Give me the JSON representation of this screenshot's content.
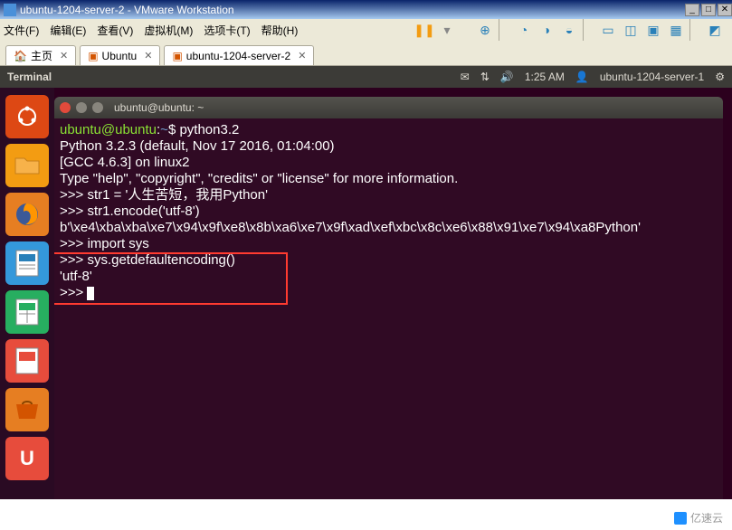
{
  "window": {
    "title": "ubuntu-1204-server-2 - VMware Workstation",
    "btn_min": "_",
    "btn_max": "□",
    "btn_close": "✕"
  },
  "menu": {
    "file": "文件(F)",
    "edit": "编辑(E)",
    "view": "查看(V)",
    "vm": "虚拟机(M)",
    "tabs": "选项卡(T)",
    "help": "帮助(H)"
  },
  "tabs": {
    "home": "主页",
    "t1": "Ubuntu",
    "t2": "ubuntu-1204-server-2"
  },
  "ubuntu_top": {
    "app": "Terminal",
    "time": "1:25 AM",
    "user": "ubuntu-1204-server-1"
  },
  "launcher": {
    "usc": "U"
  },
  "terminal": {
    "title": "ubuntu@ubuntu: ~",
    "prompt_user": "ubuntu@ubuntu",
    "prompt_path": "~",
    "cmd1": "python3.2",
    "out1": "Python 3.2.3 (default, Nov 17 2016, 01:04:00)",
    "out2": "[GCC 4.6.3] on linux2",
    "out3": "Type \"help\", \"copyright\", \"credits\" or \"license\" for more information.",
    "py1": ">>> str1 = '人生苦短，我用Python'",
    "py2": ">>> str1.encode('utf-8')",
    "py3": "b'\\xe4\\xba\\xba\\xe7\\x94\\x9f\\xe8\\x8b\\xa6\\xe7\\x9f\\xad\\xef\\xbc\\x8c\\xe6\\x88\\x91\\xe7\\x94\\xa8Python'",
    "py4": ">>> import sys",
    "py5": ">>> sys.getdefaultencoding()",
    "py6": "'utf-8'",
    "py7": ">>> "
  },
  "watermark": "亿速云"
}
